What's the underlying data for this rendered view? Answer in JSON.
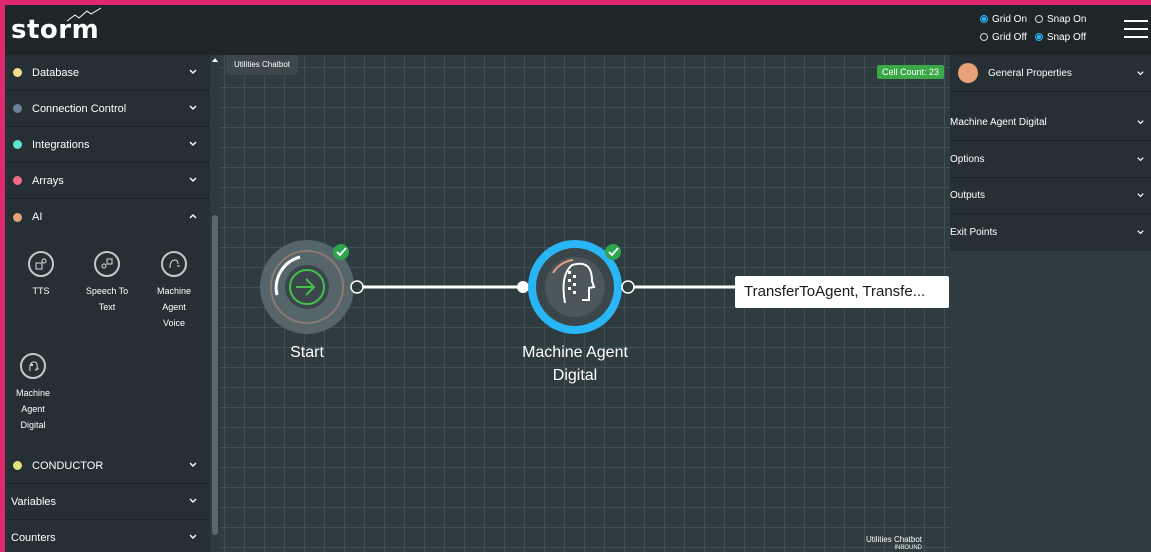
{
  "app": {
    "brand": "storm"
  },
  "view_toggles": {
    "grid_on": "Grid On",
    "snap_on": "Snap On",
    "grid_off": "Grid Off",
    "snap_off": "Snap Off",
    "selected": [
      "Grid On",
      "Snap Off"
    ]
  },
  "sidebar": {
    "items": [
      {
        "label": "Database",
        "color": "#f3dc8b"
      },
      {
        "label": "Connection Control",
        "color": "#6b8299"
      },
      {
        "label": "Integrations",
        "color": "#5fe3cf"
      },
      {
        "label": "Arrays",
        "color": "#f06a8a"
      },
      {
        "label": "AI",
        "color": "#e8a07a",
        "expanded": true
      },
      {
        "label": "CONDUCTOR",
        "color": "#e0e57a"
      },
      {
        "label": "Variables"
      },
      {
        "label": "Counters"
      }
    ],
    "ai_tools": [
      {
        "label": "TTS",
        "icon": "tts-icon"
      },
      {
        "label": "Speech To Text",
        "icon": "speech-to-text-icon"
      },
      {
        "label": "Machine Agent Voice",
        "icon": "machine-agent-voice-icon"
      },
      {
        "label": "Machine Agent Digital",
        "icon": "machine-agent-digital-icon"
      }
    ]
  },
  "canvas": {
    "tab": "Utilities Chatbot",
    "cell_count": "Cell Count: 23",
    "nodes": [
      {
        "label": "Start"
      },
      {
        "label": "Machine Agent Digital"
      }
    ],
    "exit_label": "TransferToAgent, Transfe...",
    "footer_title": "Utilities Chatbot",
    "footer_sub": "INBOUND"
  },
  "right_panel": {
    "items": [
      {
        "label": "General Properties"
      },
      {
        "label": "Machine Agent Digital"
      },
      {
        "label": "Options"
      },
      {
        "label": "Outputs"
      },
      {
        "label": "Exit Points"
      }
    ]
  },
  "colors": {
    "accent": "#29b6f6",
    "success": "#3ba84a",
    "frame": "#e0286e"
  }
}
